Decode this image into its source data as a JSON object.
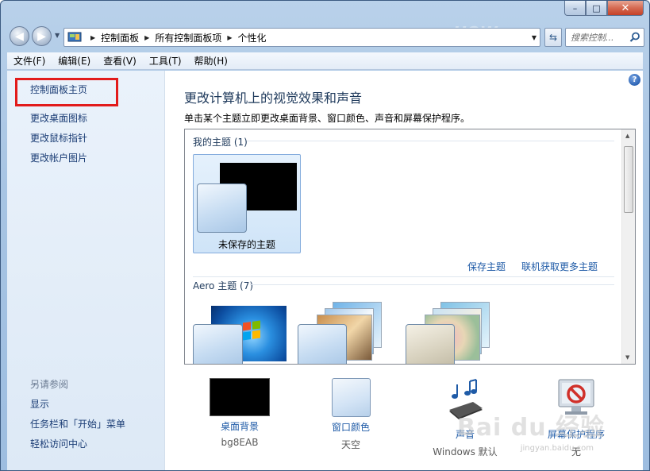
{
  "window": {
    "caption": {
      "minimize": "–",
      "maximize": "□",
      "close": "✕"
    }
  },
  "nav": {
    "breadcrumb": [
      "控制面板",
      "所有控制面板项",
      "个性化"
    ],
    "search_placeholder": "搜索控制...",
    "watermark_top": "HOW"
  },
  "menu": [
    "文件(F)",
    "编辑(E)",
    "查看(V)",
    "工具(T)",
    "帮助(H)"
  ],
  "sidebar": {
    "home": "控制面板主页",
    "links": [
      "更改桌面图标",
      "更改鼠标指针",
      "更改帐户图片"
    ],
    "see_also_title": "另请参阅",
    "see_also": [
      "显示",
      "任务栏和「开始」菜单",
      "轻松访问中心"
    ]
  },
  "main": {
    "help": "?",
    "title": "更改计算机上的视觉效果和声音",
    "subtitle": "单击某个主题立即更改桌面背景、窗口颜色、声音和屏幕保护程序。",
    "my_themes_header": "我的主题 (1)",
    "unsaved_theme": "未保存的主题",
    "save_theme": "保存主题",
    "get_more_online": "联机获取更多主题",
    "aero_header": "Aero 主题 (7)"
  },
  "bottom": [
    {
      "label": "桌面背景",
      "sub": "bg8EAB"
    },
    {
      "label": "窗口颜色",
      "sub": "天空"
    },
    {
      "label": "声音",
      "sub": "Windows 默认"
    },
    {
      "label": "屏幕保护程序",
      "sub": "无"
    }
  ],
  "watermark": {
    "brand": "Bai du 经验",
    "url": "jingyan.baidu.com"
  },
  "colors": {
    "highlight_box": "#e21b1b",
    "link": "#1f5ba7",
    "title": "#1e395b"
  }
}
